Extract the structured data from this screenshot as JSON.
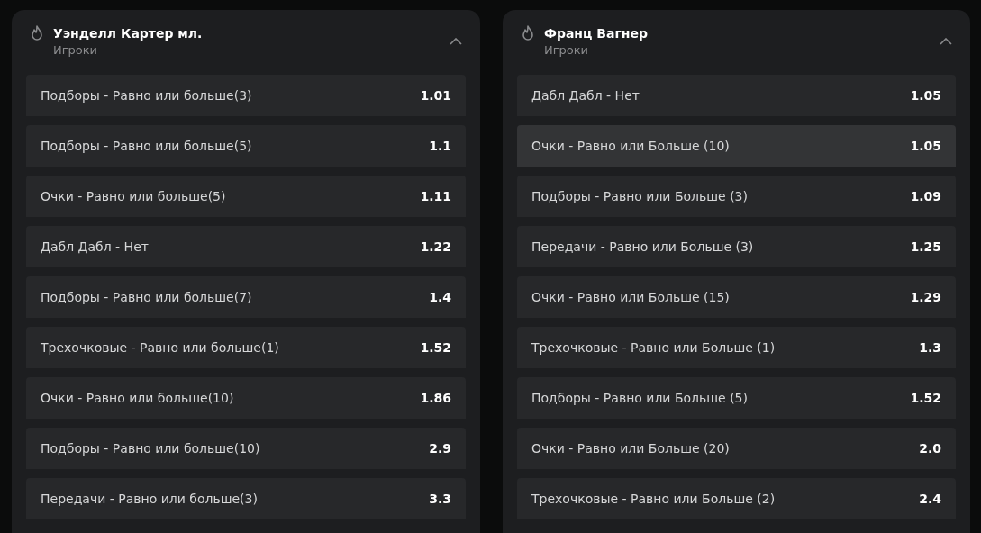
{
  "panels": [
    {
      "title": "Уэнделл Картер мл.",
      "subtitle": "Игроки",
      "expanded": true,
      "rows": [
        {
          "label": "Подборы - Равно или больше(3)",
          "odds": "1.01",
          "highlighted": false
        },
        {
          "label": "Подборы - Равно или больше(5)",
          "odds": "1.1",
          "highlighted": false
        },
        {
          "label": "Очки - Равно или больше(5)",
          "odds": "1.11",
          "highlighted": false
        },
        {
          "label": "Дабл Дабл - Нет",
          "odds": "1.22",
          "highlighted": false
        },
        {
          "label": "Подборы - Равно или больше(7)",
          "odds": "1.4",
          "highlighted": false
        },
        {
          "label": "Трехочковые - Равно или больше(1)",
          "odds": "1.52",
          "highlighted": false
        },
        {
          "label": "Очки - Равно или больше(10)",
          "odds": "1.86",
          "highlighted": false
        },
        {
          "label": "Подборы - Равно или больше(10)",
          "odds": "2.9",
          "highlighted": false
        },
        {
          "label": "Передачи - Равно или больше(3)",
          "odds": "3.3",
          "highlighted": false
        }
      ]
    },
    {
      "title": "Франц Вагнер",
      "subtitle": "Игроки",
      "expanded": true,
      "rows": [
        {
          "label": "Дабл Дабл - Нет",
          "odds": "1.05",
          "highlighted": false
        },
        {
          "label": "Очки - Равно или Больше (10)",
          "odds": "1.05",
          "highlighted": true
        },
        {
          "label": "Подборы - Равно или Больше (3)",
          "odds": "1.09",
          "highlighted": false
        },
        {
          "label": "Передачи - Равно или Больше (3)",
          "odds": "1.25",
          "highlighted": false
        },
        {
          "label": "Очки - Равно или Больше (15)",
          "odds": "1.29",
          "highlighted": false
        },
        {
          "label": "Трехочковые - Равно или Больше (1)",
          "odds": "1.3",
          "highlighted": false
        },
        {
          "label": "Подборы - Равно или Больше (5)",
          "odds": "1.52",
          "highlighted": false
        },
        {
          "label": "Очки - Равно или Больше (20)",
          "odds": "2.0",
          "highlighted": false
        },
        {
          "label": "Трехочковые - Равно или Больше (2)",
          "odds": "2.4",
          "highlighted": false
        }
      ]
    }
  ]
}
